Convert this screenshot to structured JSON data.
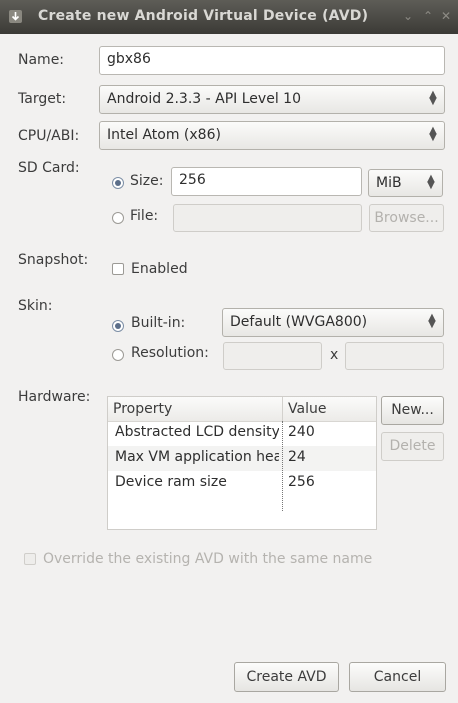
{
  "window": {
    "title": "Create new Android Virtual Device (AVD)"
  },
  "name": {
    "label": "Name:",
    "value": "gbx86"
  },
  "target": {
    "label": "Target:",
    "value": "Android 2.3.3 - API Level 10"
  },
  "cpu": {
    "label": "CPU/ABI:",
    "value": "Intel Atom (x86)"
  },
  "sdcard": {
    "label": "SD Card:",
    "size_label": "Size:",
    "size_value": "256",
    "unit": "MiB",
    "file_label": "File:",
    "file_value": "",
    "browse": "Browse..."
  },
  "snapshot": {
    "label": "Snapshot:",
    "enabled_label": "Enabled",
    "enabled": false
  },
  "skin": {
    "label": "Skin:",
    "builtin_label": "Built-in:",
    "builtin_value": "Default (WVGA800)",
    "resolution_label": "Resolution:",
    "x_label": "x",
    "res_width": "",
    "res_height": ""
  },
  "hardware": {
    "label": "Hardware:",
    "columns": [
      "Property",
      "Value"
    ],
    "rows": [
      {
        "property": "Abstracted LCD density",
        "value": "240"
      },
      {
        "property": "Max VM application heap size",
        "value": "24"
      },
      {
        "property": "Device ram size",
        "value": "256"
      }
    ],
    "new_button": "New...",
    "delete_button": "Delete"
  },
  "override": {
    "label": "Override the existing AVD with the same name",
    "checked": false
  },
  "buttons": {
    "create": "Create AVD",
    "cancel": "Cancel"
  }
}
